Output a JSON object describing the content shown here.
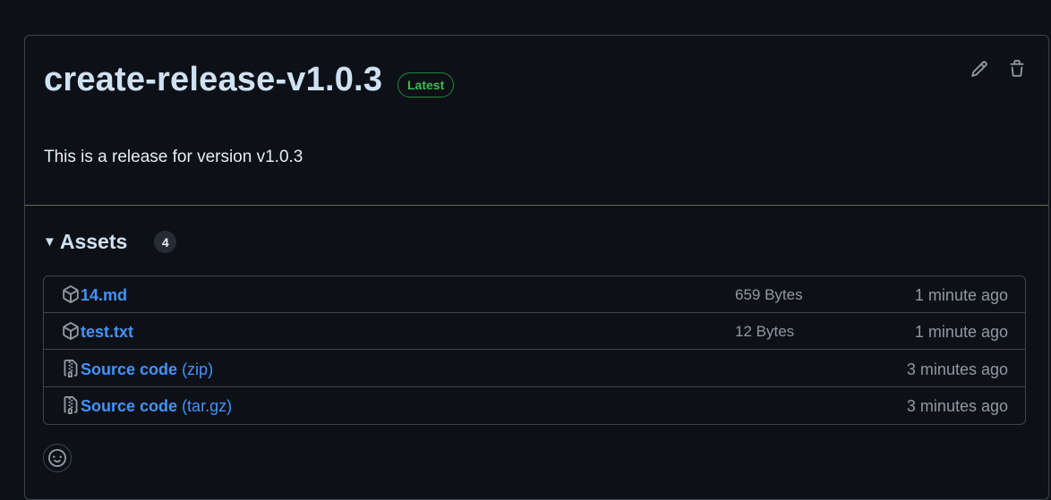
{
  "release": {
    "title": "create-release-v1.0.3",
    "badge": "Latest",
    "description": "This is a release for version v1.0.3"
  },
  "actions": {
    "edit_icon": "pencil-icon",
    "delete_icon": "trash-icon"
  },
  "assets": {
    "title": "Assets",
    "count": "4",
    "items": [
      {
        "name": "14.md",
        "ext": "",
        "size": "659 Bytes",
        "time": "1 minute ago",
        "icon": "package-icon"
      },
      {
        "name": "test.txt",
        "ext": "",
        "size": "12 Bytes",
        "time": "1 minute ago",
        "icon": "package-icon"
      },
      {
        "name": "Source code",
        "ext": "(zip)",
        "size": "",
        "time": "3 minutes ago",
        "icon": "file-zip-icon"
      },
      {
        "name": "Source code",
        "ext": "(tar.gz)",
        "size": "",
        "time": "3 minutes ago",
        "icon": "file-zip-icon"
      }
    ]
  },
  "reaction": {
    "icon": "smiley-icon"
  },
  "colors": {
    "background": "#0d1117",
    "link": "#4493f8",
    "badge": "#3fb950",
    "muted": "#9198a1"
  }
}
